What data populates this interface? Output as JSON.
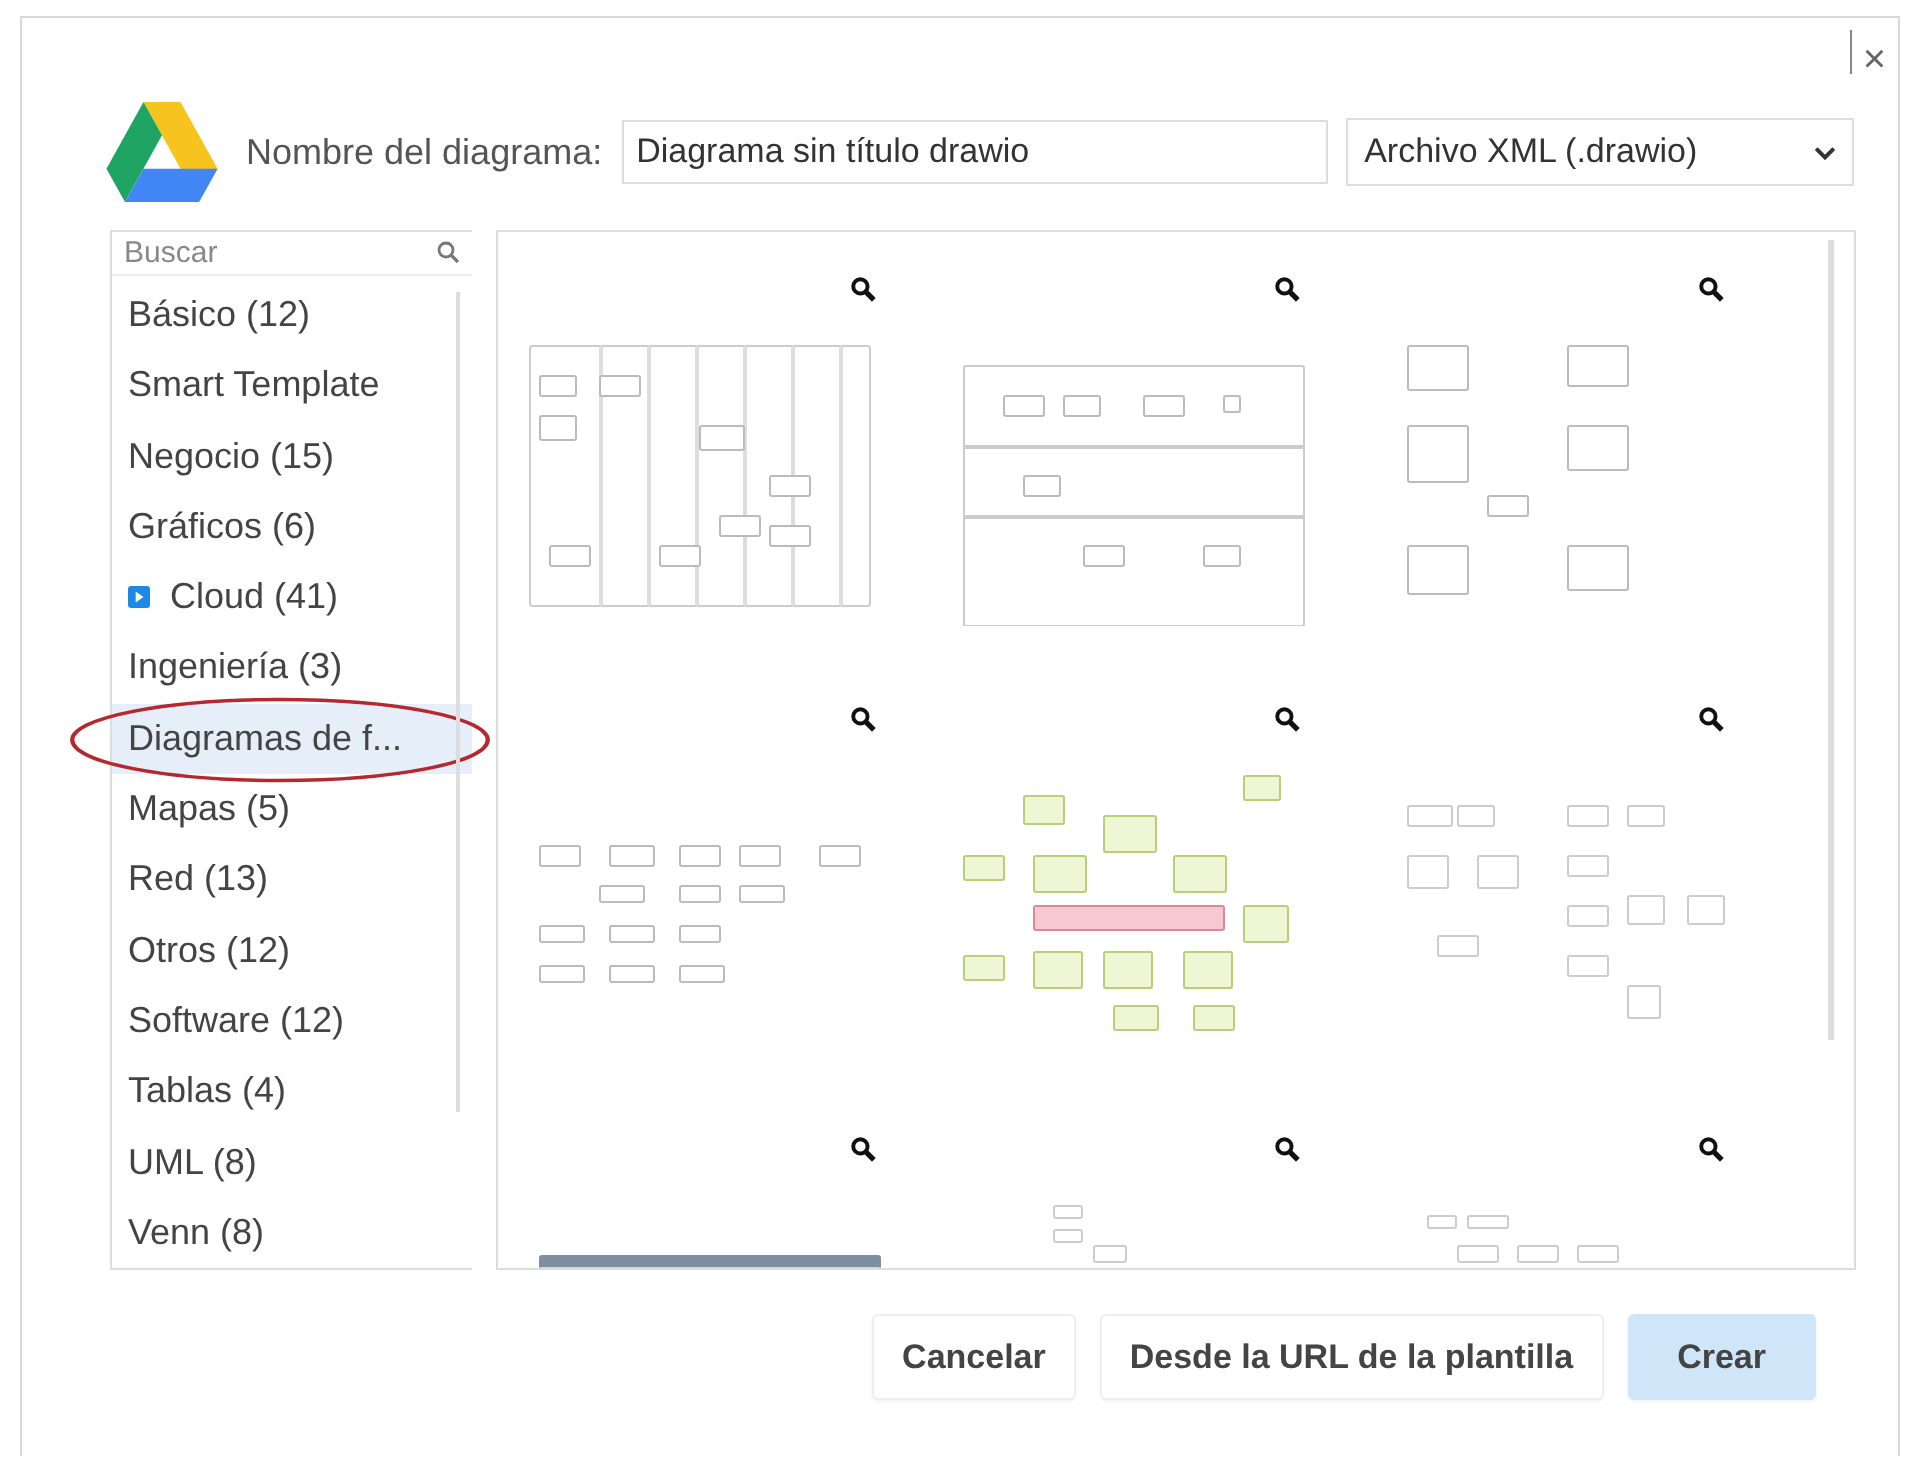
{
  "dialog": {
    "close": "×"
  },
  "header": {
    "name_label": "Nombre del diagrama:",
    "name_value": "Diagrama sin título drawio",
    "format": "Archivo XML (.drawio)"
  },
  "sidebar": {
    "search_placeholder": "Buscar",
    "items": [
      {
        "label": "Básico (12)",
        "has_icon": false,
        "selected": false,
        "circled": false
      },
      {
        "label": "Smart Template",
        "has_icon": false,
        "selected": false,
        "circled": false
      },
      {
        "label": "Negocio (15)",
        "has_icon": false,
        "selected": false,
        "circled": false
      },
      {
        "label": "Gráficos (6)",
        "has_icon": false,
        "selected": false,
        "circled": false
      },
      {
        "label": "Cloud (41)",
        "has_icon": true,
        "selected": false,
        "circled": false
      },
      {
        "label": "Ingeniería (3)",
        "has_icon": false,
        "selected": false,
        "circled": false
      },
      {
        "label": "Diagramas de f...",
        "has_icon": false,
        "selected": true,
        "circled": true
      },
      {
        "label": "Mapas (5)",
        "has_icon": false,
        "selected": false,
        "circled": false
      },
      {
        "label": "Red (13)",
        "has_icon": false,
        "selected": false,
        "circled": false
      },
      {
        "label": "Otros (12)",
        "has_icon": false,
        "selected": false,
        "circled": false
      },
      {
        "label": "Software (12)",
        "has_icon": false,
        "selected": false,
        "circled": false
      },
      {
        "label": "Tablas (4)",
        "has_icon": false,
        "selected": false,
        "circled": false
      },
      {
        "label": "UML (8)",
        "has_icon": false,
        "selected": false,
        "circled": false
      },
      {
        "label": "Venn (8)",
        "has_icon": false,
        "selected": false,
        "circled": false
      }
    ]
  },
  "templates": [
    {
      "kind": "swimlane"
    },
    {
      "kind": "process"
    },
    {
      "kind": "entities"
    },
    {
      "kind": "flow"
    },
    {
      "kind": "network"
    },
    {
      "kind": "tree"
    },
    {
      "kind": "table"
    },
    {
      "kind": "vertical"
    },
    {
      "kind": "org"
    }
  ],
  "buttons": [
    {
      "label": "Cancelar",
      "primary": false
    },
    {
      "label": "Desde la URL de la plantilla",
      "primary": false
    },
    {
      "label": "Crear",
      "primary": true
    }
  ]
}
